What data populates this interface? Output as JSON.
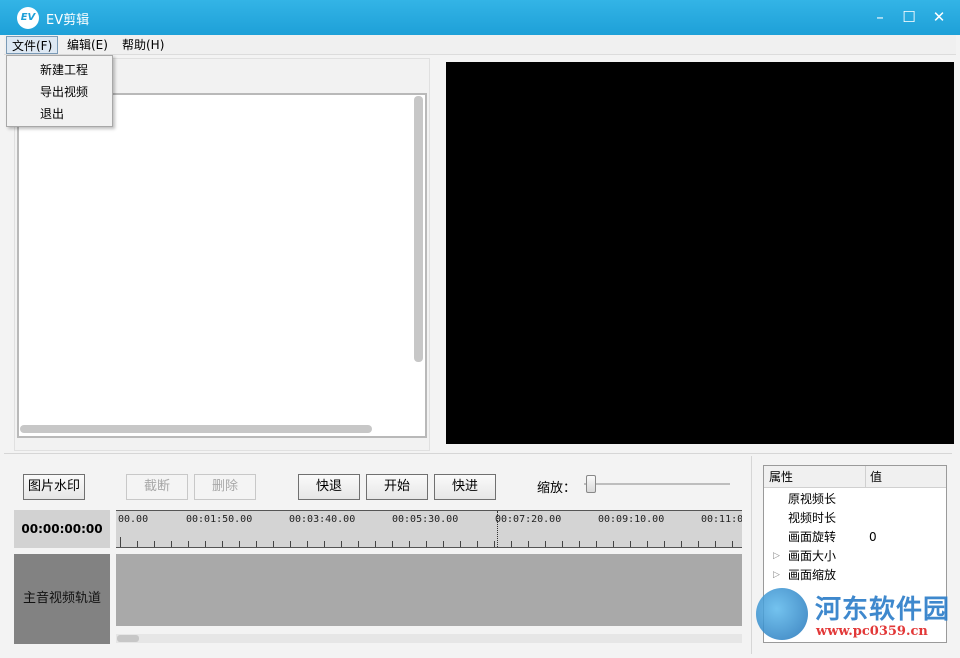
{
  "window": {
    "title": "EV剪辑",
    "logo_text": "EV",
    "controls": {
      "minimize": "–",
      "maximize": "☐",
      "close": "✕"
    }
  },
  "menubar": {
    "file": "文件(F)",
    "edit": "编辑(E)",
    "help": "帮助(H)"
  },
  "file_menu": [
    "新建工程",
    "导出视频",
    "退出"
  ],
  "toolbar": {
    "watermark": "图片水印",
    "cut": "截断",
    "delete": "删除",
    "rewind": "快退",
    "start": "开始",
    "forward": "快进",
    "zoom_label": "缩放："
  },
  "timeline": {
    "timecode": "00:00:00:00",
    "ruler_labels": [
      "00.00",
      "00:01:50.00",
      "00:03:40.00",
      "00:05:30.00",
      "00:07:20.00",
      "00:09:10.00",
      "00:11:0"
    ],
    "track_label": "主音视频轨道"
  },
  "properties": {
    "header_name": "属性",
    "header_value": "值",
    "rows": [
      {
        "name": "原视频长",
        "value": "",
        "expandable": false
      },
      {
        "name": "视频时长",
        "value": "",
        "expandable": false
      },
      {
        "name": "画面旋转",
        "value": "0",
        "expandable": false
      },
      {
        "name": "画面大小",
        "value": "",
        "expandable": true
      },
      {
        "name": "画面缩放",
        "value": "",
        "expandable": true
      }
    ]
  },
  "watermark": {
    "brand": "河东软件园",
    "url": "www.pc0359.cn"
  },
  "colors": {
    "titlebar": "#1ea0d8",
    "preview_bg": "#000000",
    "track_bg": "#a9a9a9",
    "track_label_bg": "#828282"
  }
}
